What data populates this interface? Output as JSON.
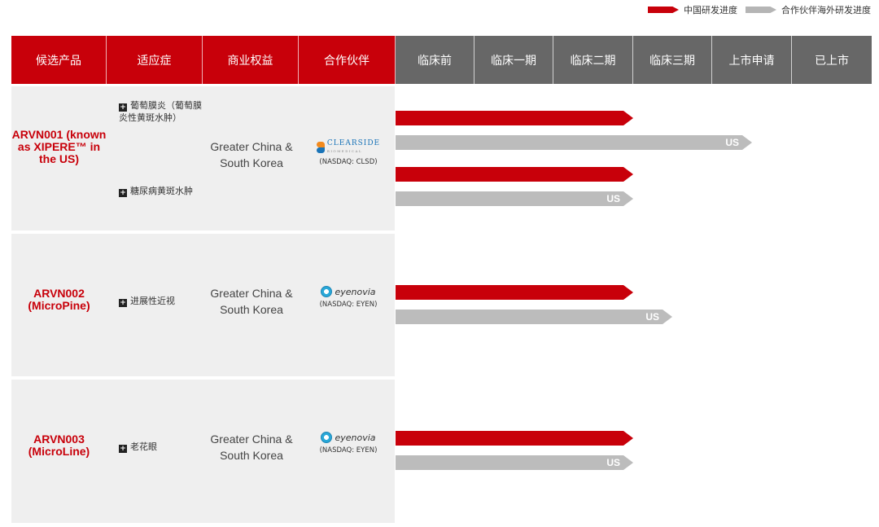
{
  "legend": {
    "china": "中国研发进度",
    "partner": "合作伙伴海外研发进度",
    "colors": {
      "china": "#c8000a",
      "partner": "#b5b5b5"
    }
  },
  "header": {
    "columns": [
      "候选产品",
      "适应症",
      "商业权益",
      "合作伙伴",
      "临床前",
      "临床一期",
      "临床二期",
      "临床三期",
      "上市申请",
      "已上市"
    ]
  },
  "products": [
    {
      "name": "ARVN001 (known as XIPERE™ in the US)",
      "indications": [
        "葡萄膜炎（葡萄膜炎性黄斑水肿）",
        "糖尿病黄斑水肿"
      ],
      "rights": "Greater China & South Korea",
      "partner_logo": "CLEARSIDE",
      "partner_logo_sub": "BIOMEDICAL",
      "partner_ticker": "(NASDAQ: CLSD)",
      "progress": [
        {
          "type": "china",
          "stage": "临床二期",
          "label": ""
        },
        {
          "type": "partner",
          "stage": "上市申请",
          "label": "US"
        },
        {
          "type": "china",
          "stage": "临床二期",
          "label": ""
        },
        {
          "type": "partner",
          "stage": "临床二期",
          "label": "US"
        }
      ]
    },
    {
      "name": "ARVN002 (MicroPine)",
      "indications": [
        "进展性近视"
      ],
      "rights": "Greater China & South Korea",
      "partner_logo": "eyenovia",
      "partner_ticker": "(NASDAQ: EYEN)",
      "progress": [
        {
          "type": "china",
          "stage": "临床二期",
          "label": ""
        },
        {
          "type": "partner",
          "stage": "临床三期",
          "label": "US"
        }
      ]
    },
    {
      "name": "ARVN003 (MicroLine)",
      "indications": [
        "老花眼"
      ],
      "rights": "Greater China & South Korea",
      "partner_logo": "eyenovia",
      "partner_ticker": "(NASDAQ: EYEN)",
      "progress": [
        {
          "type": "china",
          "stage": "临床二期",
          "label": ""
        },
        {
          "type": "partner",
          "stage": "临床二期",
          "label": "US"
        }
      ]
    }
  ]
}
